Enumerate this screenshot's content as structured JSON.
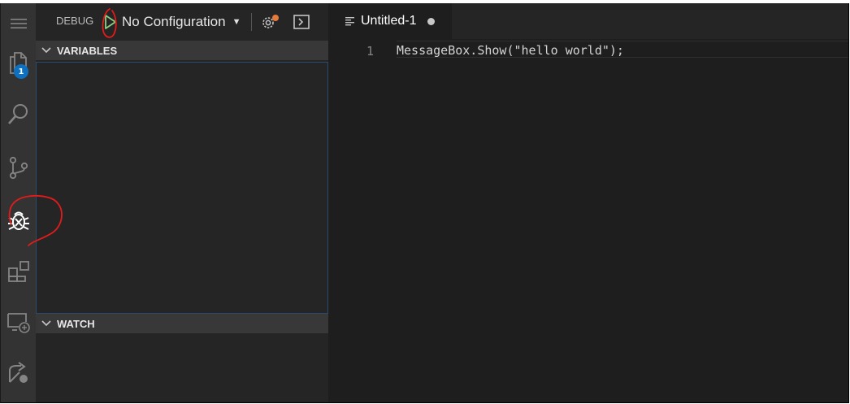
{
  "activity_bar": {
    "items": [
      {
        "name": "menu-icon"
      },
      {
        "name": "explorer-icon",
        "badge": "1"
      },
      {
        "name": "search-icon"
      },
      {
        "name": "source-control-icon"
      },
      {
        "name": "debug-icon"
      },
      {
        "name": "extensions-icon"
      },
      {
        "name": "remote-explorer-icon"
      },
      {
        "name": "live-share-icon"
      }
    ]
  },
  "debug_toolbar": {
    "label": "DEBUG",
    "configuration": "No Configuration",
    "play_icon": "play-icon",
    "settings_icon": "gear-icon",
    "console_icon": "debug-console-icon"
  },
  "sections": {
    "variables": "VARIABLES",
    "watch": "WATCH"
  },
  "editor": {
    "tab_label": "Untitled-1",
    "line_number": "1",
    "code": "MessageBox.Show(\"hello world\");"
  },
  "colors": {
    "accent_badge": "#0e70c0",
    "annotation": "#e31b1b",
    "play_green": "#89d185"
  }
}
